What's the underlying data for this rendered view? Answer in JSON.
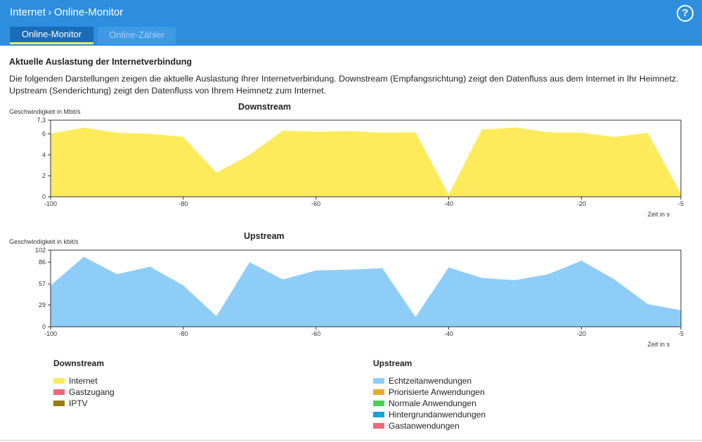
{
  "header": {
    "breadcrumb_root": "Internet",
    "breadcrumb_page": "Online-Monitor",
    "help_label": "?",
    "tabs": [
      {
        "label": "Online-Monitor",
        "active": true
      },
      {
        "label": "Online-Zähler",
        "active": false
      }
    ]
  },
  "main": {
    "section_title": "Aktuelle Auslastung der Internetverbindung",
    "description": "Die folgenden Darstellungen zeigen die aktuelle Auslastung Ihrer Internetverbindung. Downstream (Empfangsrichtung) zeigt den Datenfluss aus dem Internet in Ihr Heimnetz. Upstream (Senderichtung) zeigt den Datenfluss von Ihrem Heimnetz zum Internet."
  },
  "colors": {
    "header_bg": "#2d8ee0",
    "downstream_fill": "#fdeb5b",
    "upstream_fill": "#8ecdf8"
  },
  "chart_data": [
    {
      "type": "area",
      "title": "Downstream",
      "ylabel": "Geschwindigkeit in Mbit/s",
      "xlabel": "Zeit in s",
      "xlim": [
        -100,
        -5
      ],
      "ylim": [
        0,
        7.3
      ],
      "yticks": [
        "0",
        "2",
        "4",
        "6",
        "7,3"
      ],
      "xticks": [
        "-100",
        "-80",
        "-60",
        "-40",
        "-20",
        "-5"
      ],
      "grid": false,
      "x": [
        -100,
        -95,
        -90,
        -85,
        -80,
        -75,
        -70,
        -65,
        -60,
        -55,
        -50,
        -45,
        -40,
        -35,
        -30,
        -25,
        -20,
        -15,
        -10,
        -5
      ],
      "series": [
        {
          "name": "Internet",
          "color": "#fdeb5b",
          "values": [
            6.0,
            6.6,
            6.1,
            6.0,
            5.7,
            2.3,
            4.0,
            6.3,
            6.2,
            6.25,
            6.1,
            6.15,
            0.2,
            6.4,
            6.6,
            6.15,
            6.1,
            5.7,
            6.1,
            0.3
          ]
        }
      ]
    },
    {
      "type": "area",
      "title": "Upstream",
      "ylabel": "Geschwindigkeit in kbit/s",
      "xlabel": "Zeit in s",
      "xlim": [
        -100,
        -5
      ],
      "ylim": [
        0,
        102
      ],
      "yticks": [
        "0",
        "29",
        "57",
        "86",
        "102"
      ],
      "xticks": [
        "-100",
        "-80",
        "-60",
        "-40",
        "-20",
        "-5"
      ],
      "grid": false,
      "x": [
        -100,
        -95,
        -90,
        -85,
        -80,
        -75,
        -70,
        -65,
        -60,
        -55,
        -50,
        -45,
        -40,
        -35,
        -30,
        -25,
        -20,
        -15,
        -10,
        -5
      ],
      "series": [
        {
          "name": "Echtzeitanwendungen",
          "color": "#8ecdf8",
          "values": [
            55,
            93,
            70,
            80,
            55,
            14,
            86,
            63,
            75,
            76,
            78,
            13,
            79,
            65,
            62,
            70,
            88,
            63,
            30,
            22
          ]
        }
      ]
    }
  ],
  "legend": {
    "downstream": {
      "title": "Downstream",
      "items": [
        {
          "label": "Internet",
          "color": "#fdeb5b"
        },
        {
          "label": "Gastzugang",
          "color": "#ec6a7a"
        },
        {
          "label": "IPTV",
          "color": "#9a7a0a"
        }
      ]
    },
    "upstream": {
      "title": "Upstream",
      "items": [
        {
          "label": "Echtzeitanwendungen",
          "color": "#8ecdf8"
        },
        {
          "label": "Priorisierte Anwendungen",
          "color": "#e6ac2a"
        },
        {
          "label": "Normale Anwendungen",
          "color": "#4ccf5a"
        },
        {
          "label": "Hintergrundanwendungen",
          "color": "#18a4d8"
        },
        {
          "label": "Gastanwendungen",
          "color": "#ec6a7a"
        }
      ]
    }
  }
}
